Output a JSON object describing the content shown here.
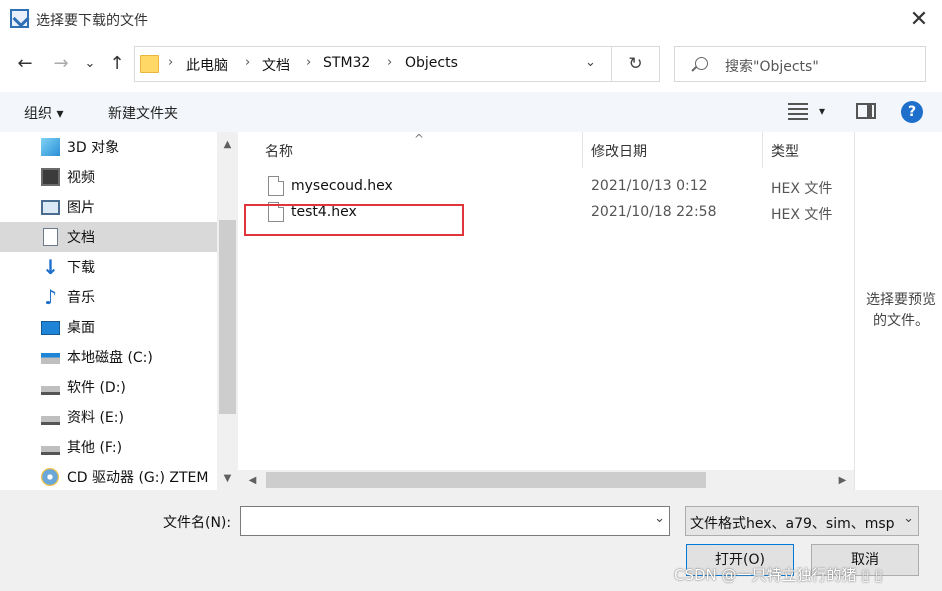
{
  "window": {
    "title": "选择要下载的文件",
    "close_label": "✕"
  },
  "nav": {
    "back": "←",
    "forward": "→",
    "recent": "⌄",
    "up": "↑",
    "breadcrumb": [
      "此电脑",
      "文档",
      "STM32",
      "Objects"
    ],
    "separator": "›",
    "dropdown": "⌄",
    "refresh": "↻",
    "search_placeholder": "搜索\"Objects\""
  },
  "toolbar": {
    "organize": "组织 ▾",
    "new_folder": "新建文件夹",
    "view_dropdown": "▾",
    "help": "?"
  },
  "sidebar": {
    "items": [
      {
        "label": "3D 对象",
        "icon": "3d-objects-icon"
      },
      {
        "label": "视频",
        "icon": "video-icon"
      },
      {
        "label": "图片",
        "icon": "pictures-icon"
      },
      {
        "label": "文档",
        "icon": "documents-icon",
        "selected": true
      },
      {
        "label": "下载",
        "icon": "downloads-icon"
      },
      {
        "label": "音乐",
        "icon": "music-icon"
      },
      {
        "label": "桌面",
        "icon": "desktop-icon"
      },
      {
        "label": "本地磁盘 (C:)",
        "icon": "system-drive-icon"
      },
      {
        "label": "软件 (D:)",
        "icon": "drive-icon"
      },
      {
        "label": "资料 (E:)",
        "icon": "drive-icon"
      },
      {
        "label": " 其他 (F:)",
        "icon": "drive-icon"
      },
      {
        "label": "CD 驱动器 (G:) ZTEM",
        "icon": "cd-drive-icon"
      }
    ]
  },
  "filelist": {
    "columns": {
      "name": "名称",
      "date": "修改日期",
      "type": "类型"
    },
    "sort_caret": "^",
    "rows": [
      {
        "name": "mysecoud.hex",
        "date": "2021/10/13 0:12",
        "type": "HEX 文件"
      },
      {
        "name": "test4.hex",
        "date": "2021/10/18 22:58",
        "type": "HEX 文件"
      }
    ]
  },
  "preview": {
    "text": "选择要预览的文件。"
  },
  "bottom": {
    "filename_label": "文件名(N):",
    "filename_value": "",
    "filter_text": "文件格式hex、a79、sim、msp",
    "open_button": "打开(O)",
    "cancel_button": "取消"
  },
  "watermark": "CSDN @一只特立独行的猪 ▯ ▯",
  "colors": {
    "highlight_border": "#e0353a",
    "help_blue": "#1e6fcc",
    "toolbar_bg": "#f3f6fb",
    "selected_bg": "#d9d9d9"
  }
}
